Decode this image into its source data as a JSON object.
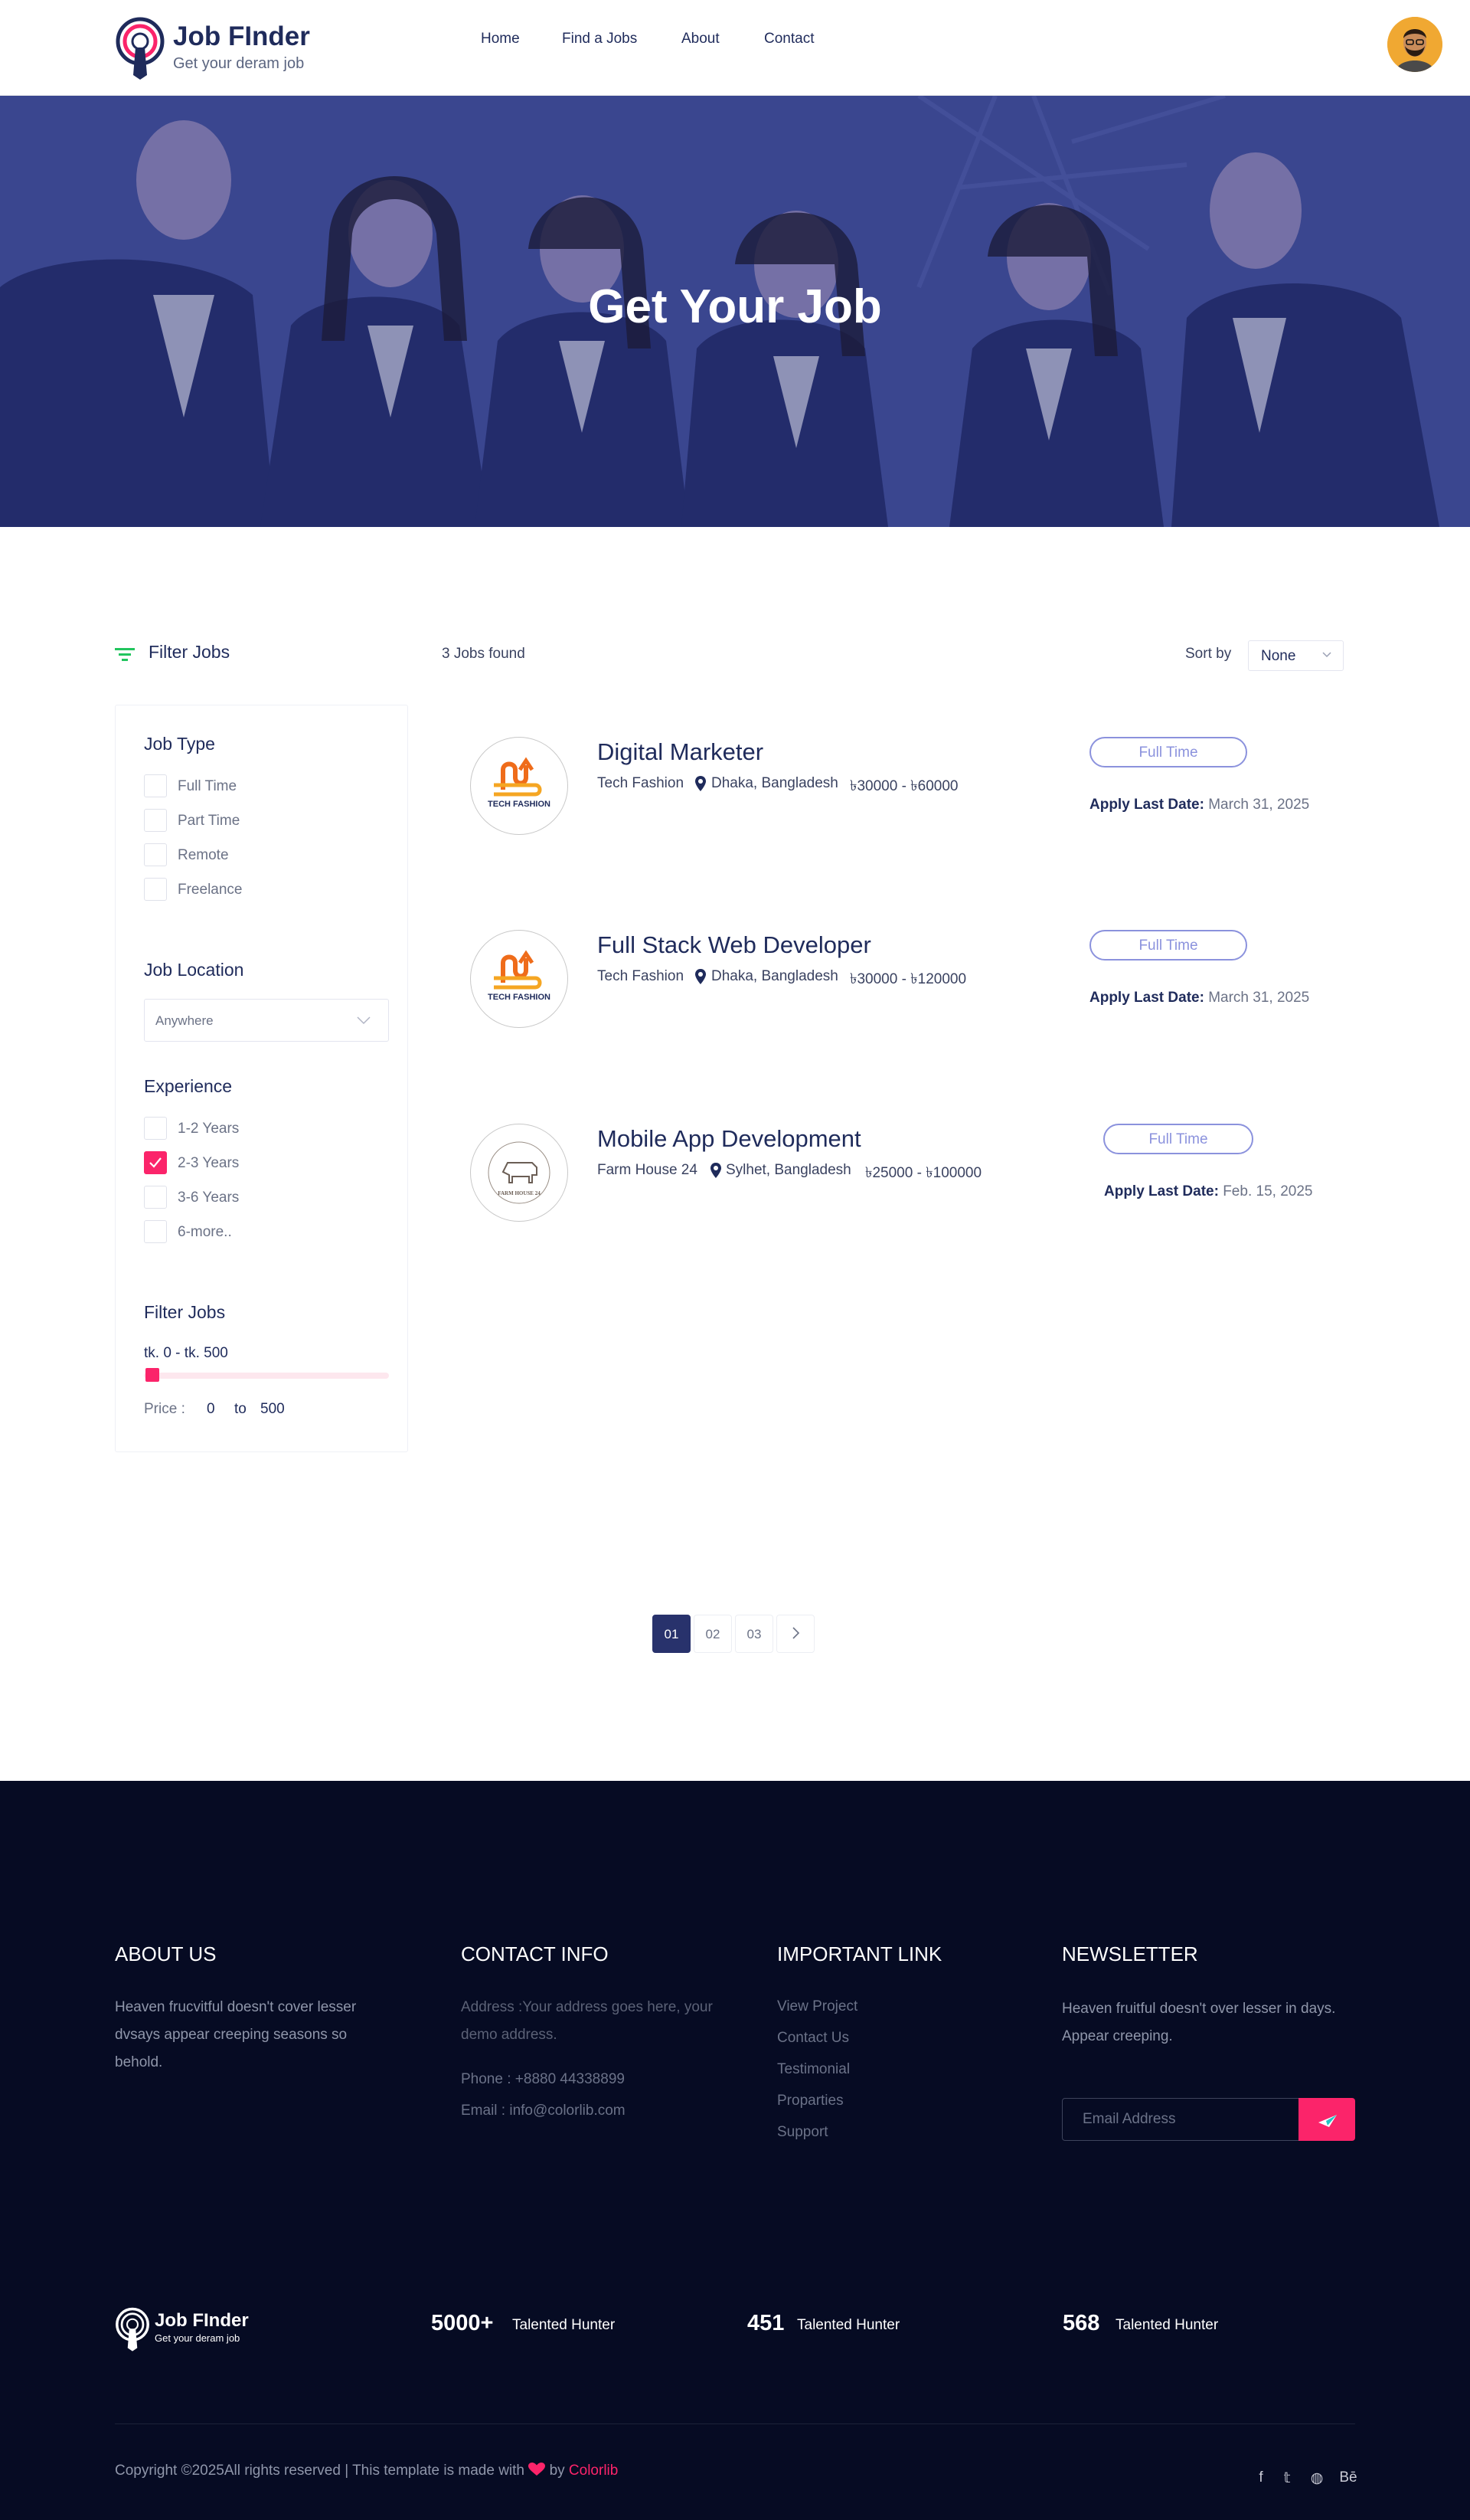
{
  "brand": {
    "name": "Job FInder",
    "tagline": "Get your deram job"
  },
  "nav": [
    {
      "label": "Home"
    },
    {
      "label": "Find a Jobs"
    },
    {
      "label": "About"
    },
    {
      "label": "Contact"
    }
  ],
  "hero": {
    "title": "Get Your Job"
  },
  "filter": {
    "heading": "Filter Jobs",
    "job_type": {
      "heading": "Job Type",
      "options": [
        "Full Time",
        "Part Time",
        "Remote",
        "Freelance"
      ]
    },
    "job_location": {
      "heading": "Job Location",
      "selected": "Anywhere"
    },
    "experience": {
      "heading": "Experience",
      "options": [
        "1-2 Years",
        "2-3 Years",
        "3-6 Years",
        "6-more.."
      ],
      "checked_index": 1
    },
    "price": {
      "heading": "Filter Jobs",
      "range_text": "tk. 0 - tk. 500",
      "label": "Price :",
      "min": "0",
      "to": "to",
      "max": "500",
      "slider_position": 0
    }
  },
  "results": {
    "count_text": "3 Jobs found",
    "sort_label": "Sort by",
    "sort_value": "None"
  },
  "jobs": [
    {
      "title": "Digital Marketer",
      "company": "Tech Fashion",
      "location": "Dhaka, Bangladesh",
      "salary": "৳30000 - ৳60000",
      "type": "Full Time",
      "deadline_label": "Apply Last Date:",
      "deadline": "March 31, 2025",
      "logo_text": "TECH FASHION"
    },
    {
      "title": "Full Stack Web Developer",
      "company": "Tech Fashion",
      "location": "Dhaka, Bangladesh",
      "salary": "৳30000 - ৳120000",
      "type": "Full Time",
      "deadline_label": "Apply Last Date:",
      "deadline": "March 31, 2025",
      "logo_text": "TECH FASHION"
    },
    {
      "title": "Mobile App Development",
      "company": "Farm House 24",
      "location": "Sylhet, Bangladesh",
      "salary": "৳25000 - ৳100000",
      "type": "Full Time",
      "deadline_label": "Apply Last Date:",
      "deadline": "Feb. 15, 2025",
      "logo_text": "FARM HOUSE 24"
    }
  ],
  "pagination": {
    "pages": [
      "01",
      "02",
      "03"
    ],
    "active": "01"
  },
  "footer": {
    "about": {
      "heading": "ABOUT US",
      "text": "Heaven frucvitful doesn't cover lesser dvsays appear creeping seasons so behold."
    },
    "contact": {
      "heading": "CONTACT INFO",
      "address": "Address :Your address goes here, your demo address.",
      "phone": "Phone : +8880 44338899",
      "email": "Email : info@colorlib.com"
    },
    "links": {
      "heading": "IMPORTANT LINK",
      "items": [
        "View Project",
        "Contact Us",
        "Testimonial",
        "Proparties",
        "Support"
      ]
    },
    "newsletter": {
      "heading": "NEWSLETTER",
      "text": "Heaven fruitful doesn't over lesser in days. Appear creeping.",
      "placeholder": "Email Address"
    },
    "stats": [
      {
        "number": "5000+",
        "label": "Talented Hunter"
      },
      {
        "number": "451",
        "label": "Talented Hunter"
      },
      {
        "number": "568",
        "label": "Talented Hunter"
      }
    ],
    "copyright_prefix": "Copyright ©2025All rights reserved | This template is made with",
    "copyright_by": "by",
    "copyright_brand": "Colorlib",
    "social": [
      {
        "icon": "facebook-icon",
        "glyph": "f"
      },
      {
        "icon": "twitter-icon",
        "glyph": "𝕥"
      },
      {
        "icon": "globe-icon",
        "glyph": "◍"
      },
      {
        "icon": "behance-icon",
        "glyph": "Bē"
      }
    ]
  },
  "colors": {
    "primary": "#1f2b5b",
    "accent": "#fb246a",
    "badge": "#8b92dd",
    "footer_bg": "#060b23",
    "hero_overlay": "#2b3785"
  }
}
